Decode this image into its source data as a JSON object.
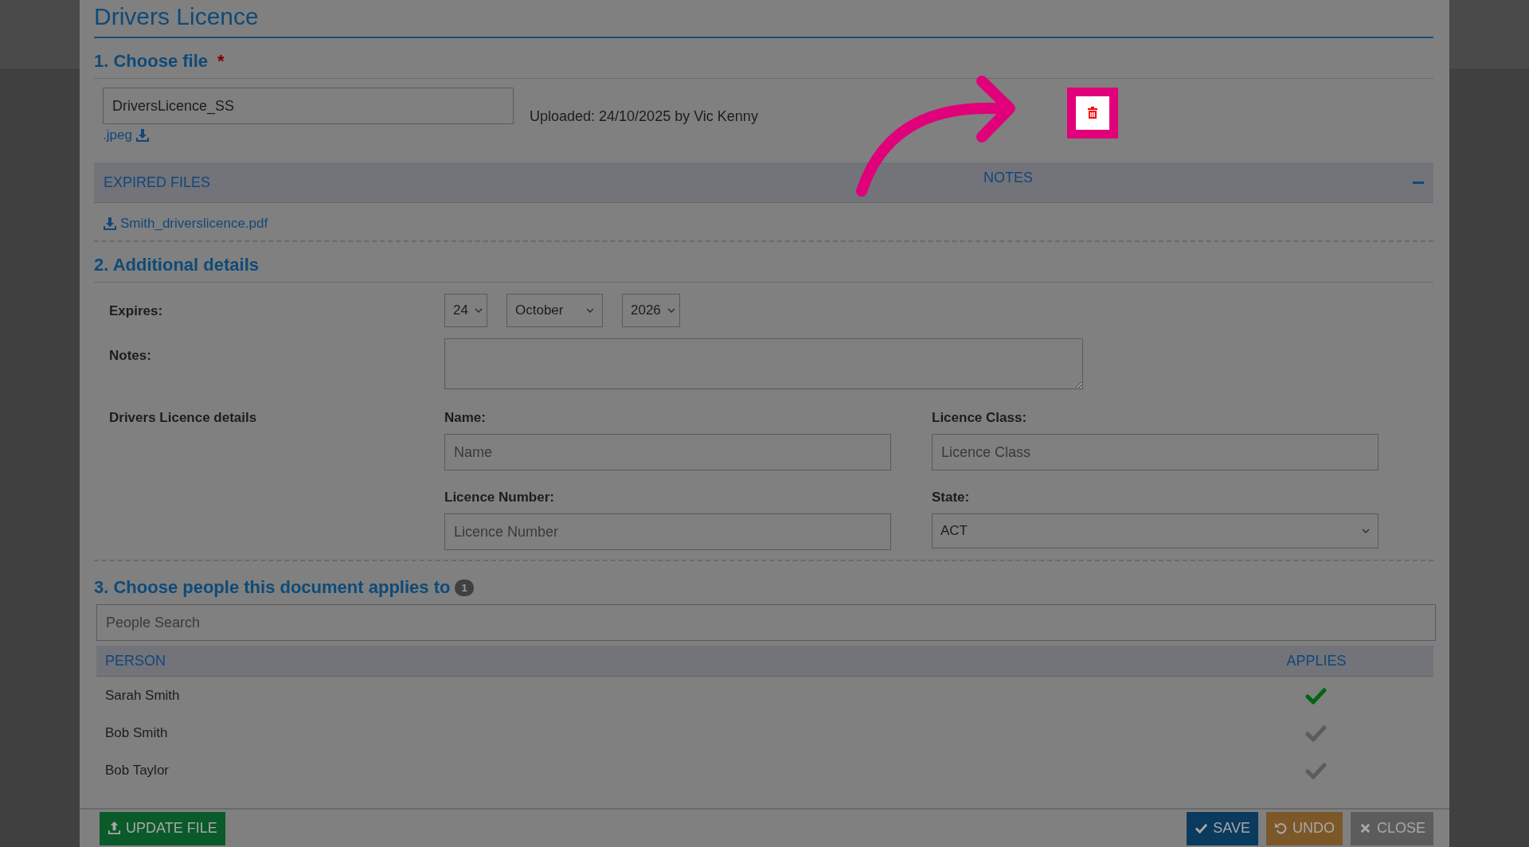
{
  "dialog": {
    "title": "Drivers Licence"
  },
  "choose_file": {
    "heading": "1. Choose file",
    "required_mark": "*",
    "file_name": "DriversLicence_SS",
    "extension": ".jpeg",
    "uploaded": "Uploaded: 24/10/2025 by Vic Kenny",
    "delete_button": {
      "highlighted": true
    }
  },
  "files_panel": {
    "columns": [
      "EXPIRED FILES",
      "NOTES"
    ],
    "expanded": true,
    "expired_files": [
      {
        "name": "Smith_driverslicence.pdf"
      }
    ]
  },
  "additional_details": {
    "heading": "2. Additional details",
    "expires": {
      "label": "Expires:",
      "day": "24",
      "month": "October",
      "year": "2026"
    },
    "notes": {
      "label": "Notes:"
    },
    "licence_details": {
      "label": "Drivers Licence details",
      "fields": [
        {
          "kind": "input",
          "label": "Name:",
          "placeholder": "Name"
        },
        {
          "kind": "input",
          "label": "Licence Class:",
          "placeholder": "Licence Class"
        },
        {
          "kind": "input",
          "label": "Licence Number:",
          "placeholder": "Licence Number"
        },
        {
          "kind": "select",
          "label": "State:",
          "value": "ACT"
        }
      ]
    }
  },
  "people": {
    "heading": "3. Choose people this document applies to",
    "count": "1",
    "search_placeholder": "People Search",
    "columns": [
      "PERSON",
      "APPLIES"
    ],
    "rows": [
      {
        "name": "Sarah Smith",
        "applies": true
      },
      {
        "name": "Bob Smith",
        "applies": false
      },
      {
        "name": "Bob Taylor",
        "applies": false
      }
    ]
  },
  "footer": {
    "buttons": [
      {
        "kind": "update",
        "label": "UPDATE FILE"
      },
      {
        "kind": "save",
        "label": "SAVE"
      },
      {
        "kind": "undo",
        "label": "UNDO"
      },
      {
        "kind": "close",
        "label": "CLOSE"
      }
    ]
  }
}
